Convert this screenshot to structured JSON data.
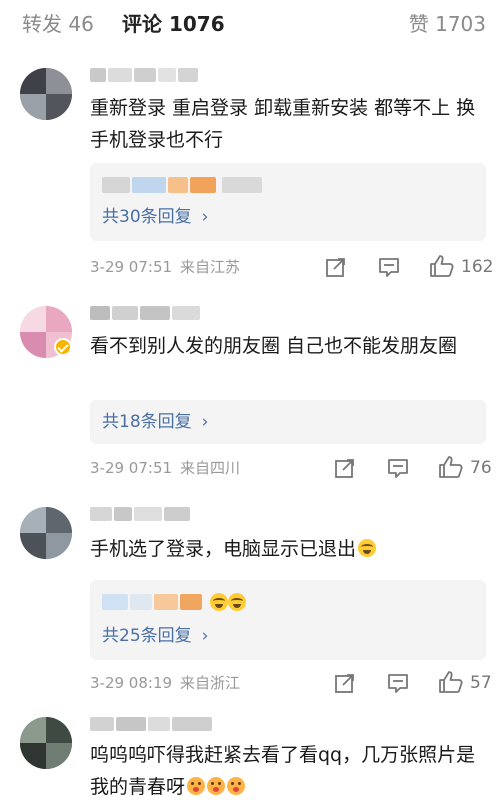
{
  "tabs": {
    "repost": "转发 46",
    "comments": "评论 1076",
    "likes": "赞 1703"
  },
  "colors": {
    "accent": "#ff8200",
    "link": "#4a6fa5",
    "meta": "#999999"
  },
  "comments": [
    {
      "username": "",
      "verified": false,
      "text": "重新登录 重启登录 卸载重新安装 都等不上 换手机登录也不行",
      "replies_label": "共30条回复",
      "time": "3-29 07:51",
      "location": "来自江苏",
      "likes": "162"
    },
    {
      "username": "",
      "verified": true,
      "text": "看不到别人发的朋友圈 自己也不能发朋友圈",
      "replies_label": "共18条回复",
      "time": "3-29 07:51",
      "location": "来自四川",
      "likes": "76"
    },
    {
      "username": "",
      "verified": false,
      "text": "手机选了登录，电脑显示已退出",
      "replies_label": "共25条回复",
      "time": "3-29 08:19",
      "location": "来自浙江",
      "likes": "57"
    },
    {
      "username": "",
      "verified": false,
      "text": "呜呜呜吓得我赶紧去看了看qq，几万张照片是我的青春呀"
    }
  ],
  "icons": {
    "share": "share-icon",
    "comment": "comment-icon",
    "like": "thumbs-up-icon",
    "chevron": "chevron-right-icon"
  }
}
